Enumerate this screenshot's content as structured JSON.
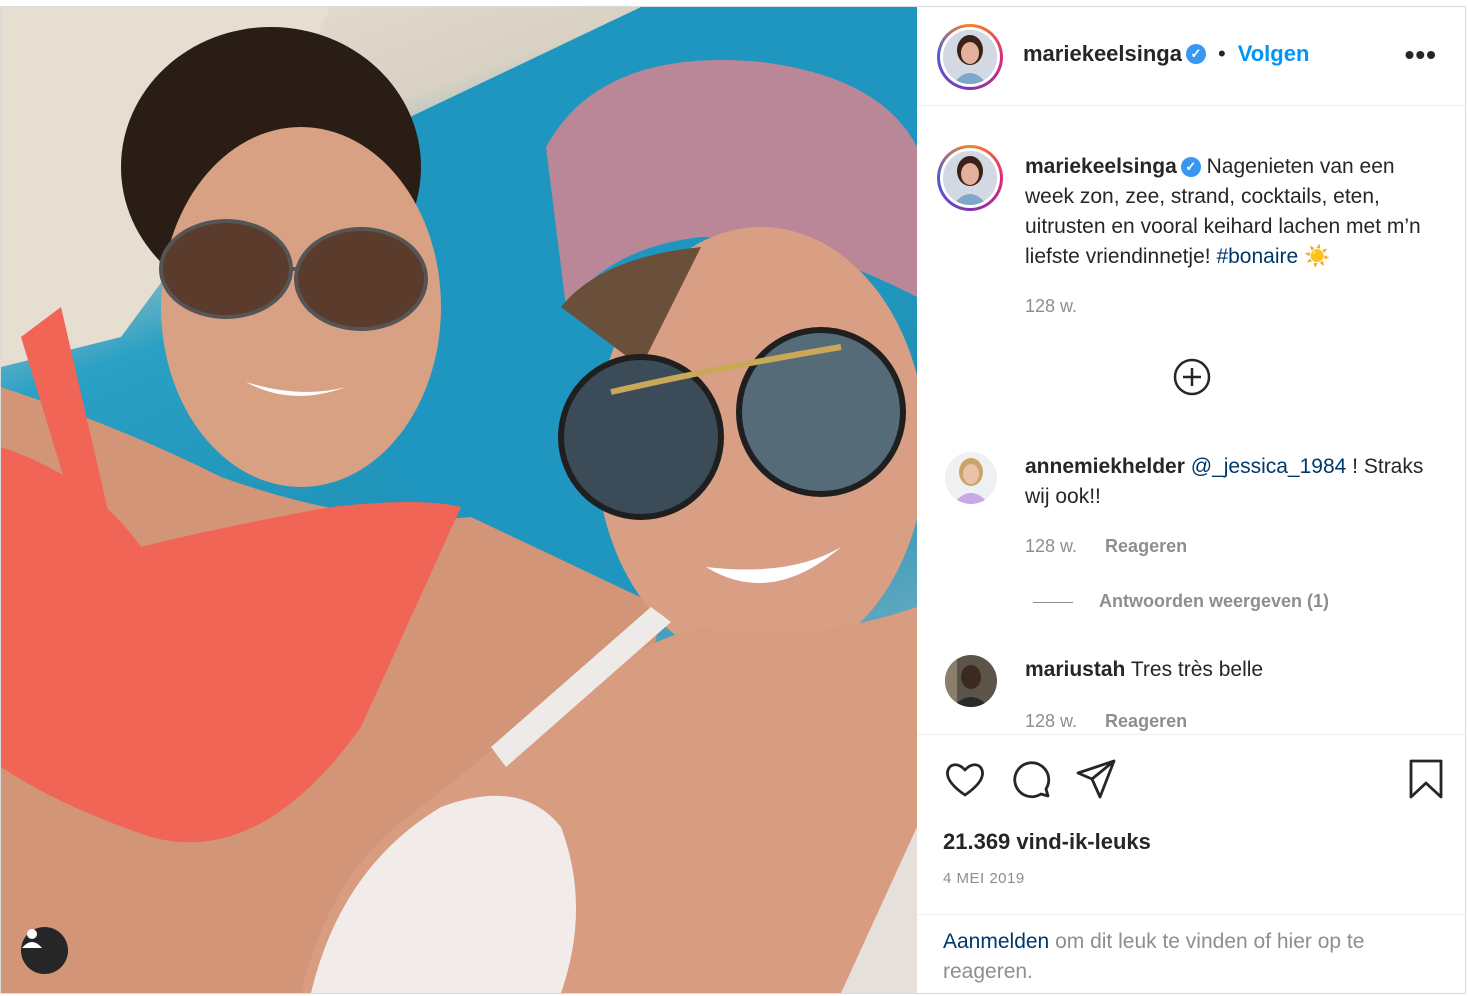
{
  "post": {
    "username": "mariekeelsinga",
    "verified_icon": "verified-badge-icon",
    "follow_label": "Volgen",
    "separator": "•",
    "more_icon": "more-options-icon"
  },
  "caption": {
    "username": "mariekeelsinga",
    "text": "Nagenieten van een week zon, zee, strand, cocktails, eten, uitrusten en vooral keihard lachen met m’n liefste vriendinnetje! ",
    "hashtag": "#bonaire",
    "emoji": "☀️",
    "time": "128 w."
  },
  "load_more_icon": "plus-circle-icon",
  "comments": [
    {
      "username": "annemiekhelder",
      "mention": "@_jessica_1984",
      "text": " ! Straks wij ook!!",
      "time": "128 w.",
      "reply_label": "Reageren",
      "view_replies": "Antwoorden weergeven (1)"
    },
    {
      "username": "mariustah",
      "text": "Tres très belle",
      "time": "128 w.",
      "reply_label": "Reageren"
    }
  ],
  "actions": {
    "like_icon": "heart-icon",
    "comment_icon": "comment-icon",
    "share_icon": "share-icon",
    "save_icon": "bookmark-icon"
  },
  "likes": "21.369 vind-ik-leuks",
  "date": "4 MEI 2019",
  "login": {
    "link": "Aanmelden",
    "text": " om dit leuk te vinden of hier op te reageren."
  },
  "colors": {
    "accent": "#0095f6",
    "link_dark": "#00376b",
    "muted": "#8e8e8e"
  }
}
